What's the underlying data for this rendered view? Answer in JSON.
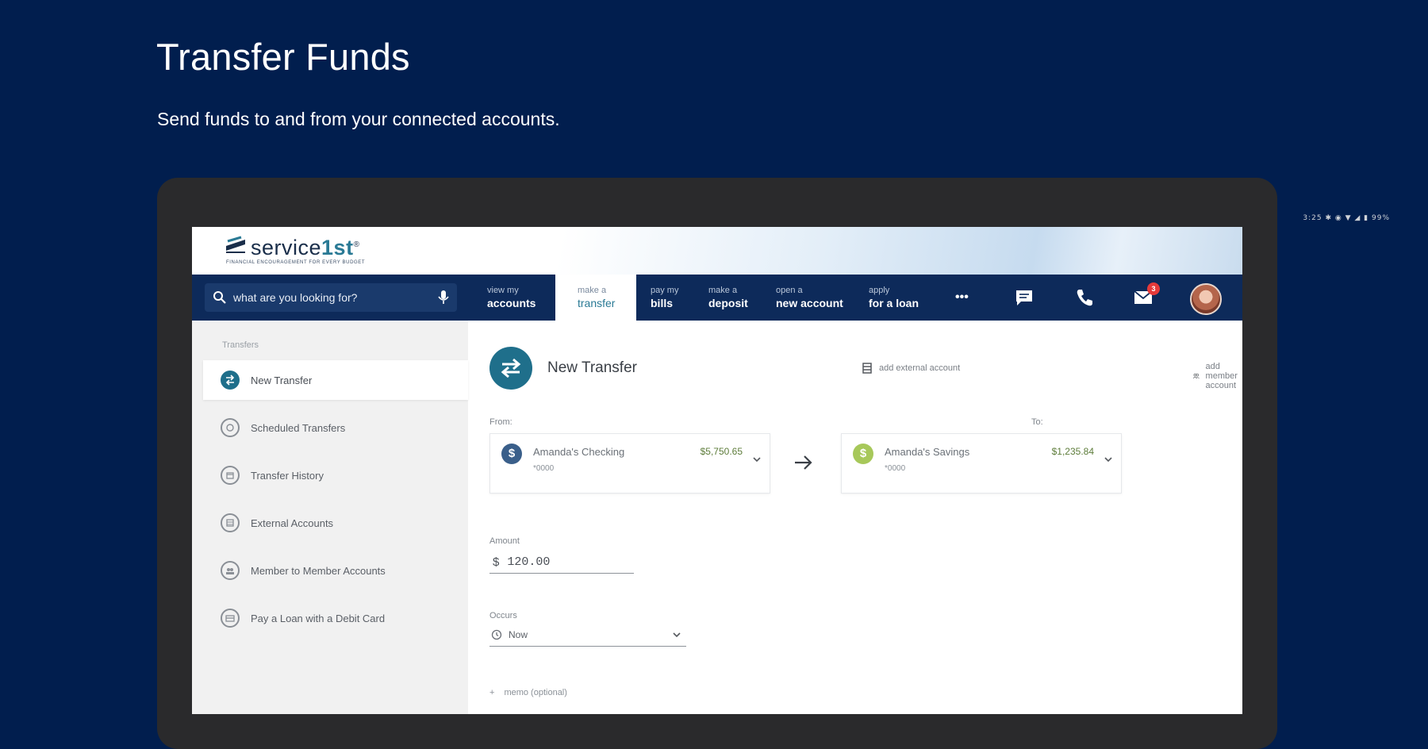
{
  "promo": {
    "title": "Transfer Funds",
    "subtitle": "Send funds to and from your connected accounts."
  },
  "status_bar": {
    "text": "3:25 ✱ ◉ ▼ ◢ ▮ 99%"
  },
  "brand": {
    "name_prefix": "service",
    "name_accent": "1st",
    "trademark": "®",
    "tagline": "FINANCIAL ENCOURAGEMENT FOR EVERY BUDGET"
  },
  "search": {
    "placeholder": "what are you looking for?"
  },
  "nav": {
    "items": [
      {
        "small": "view my",
        "big": "accounts"
      },
      {
        "small": "make a",
        "big": "transfer"
      },
      {
        "small": "pay my",
        "big": "bills"
      },
      {
        "small": "make a",
        "big": "deposit"
      },
      {
        "small": "open a",
        "big": "new account"
      },
      {
        "small": "apply",
        "big": "for a loan"
      }
    ],
    "more_label": "•••",
    "mail_badge": "3"
  },
  "sidebar": {
    "heading": "Transfers",
    "items": [
      {
        "label": "New Transfer"
      },
      {
        "label": "Scheduled Transfers"
      },
      {
        "label": "Transfer History"
      },
      {
        "label": "External Accounts"
      },
      {
        "label": "Member to Member Accounts"
      },
      {
        "label": "Pay a Loan with a Debit Card"
      }
    ]
  },
  "main": {
    "title": "New Transfer",
    "add_external": "add external account",
    "add_member": "add member account",
    "from_label": "From:",
    "to_label": "To:",
    "from": {
      "icon": "$",
      "name": "Amanda's Checking",
      "number": "*0000",
      "balance": "$5,750.65"
    },
    "to": {
      "icon": "$",
      "name": "Amanda's Savings",
      "number": "*0000",
      "balance": "$1,235.84"
    },
    "amount_label": "Amount",
    "currency": "$",
    "amount_value": "120.00",
    "occurs_label": "Occurs",
    "occurs_value": "Now",
    "memo_plus": "+",
    "memo_label": "memo (optional)"
  },
  "colors": {
    "page_bg": "#011e4e",
    "nav_bg": "#0d2a5a",
    "accent_teal": "#1f6f8b",
    "savings_green": "#a7c85a",
    "badge_red": "#e53a3a"
  }
}
